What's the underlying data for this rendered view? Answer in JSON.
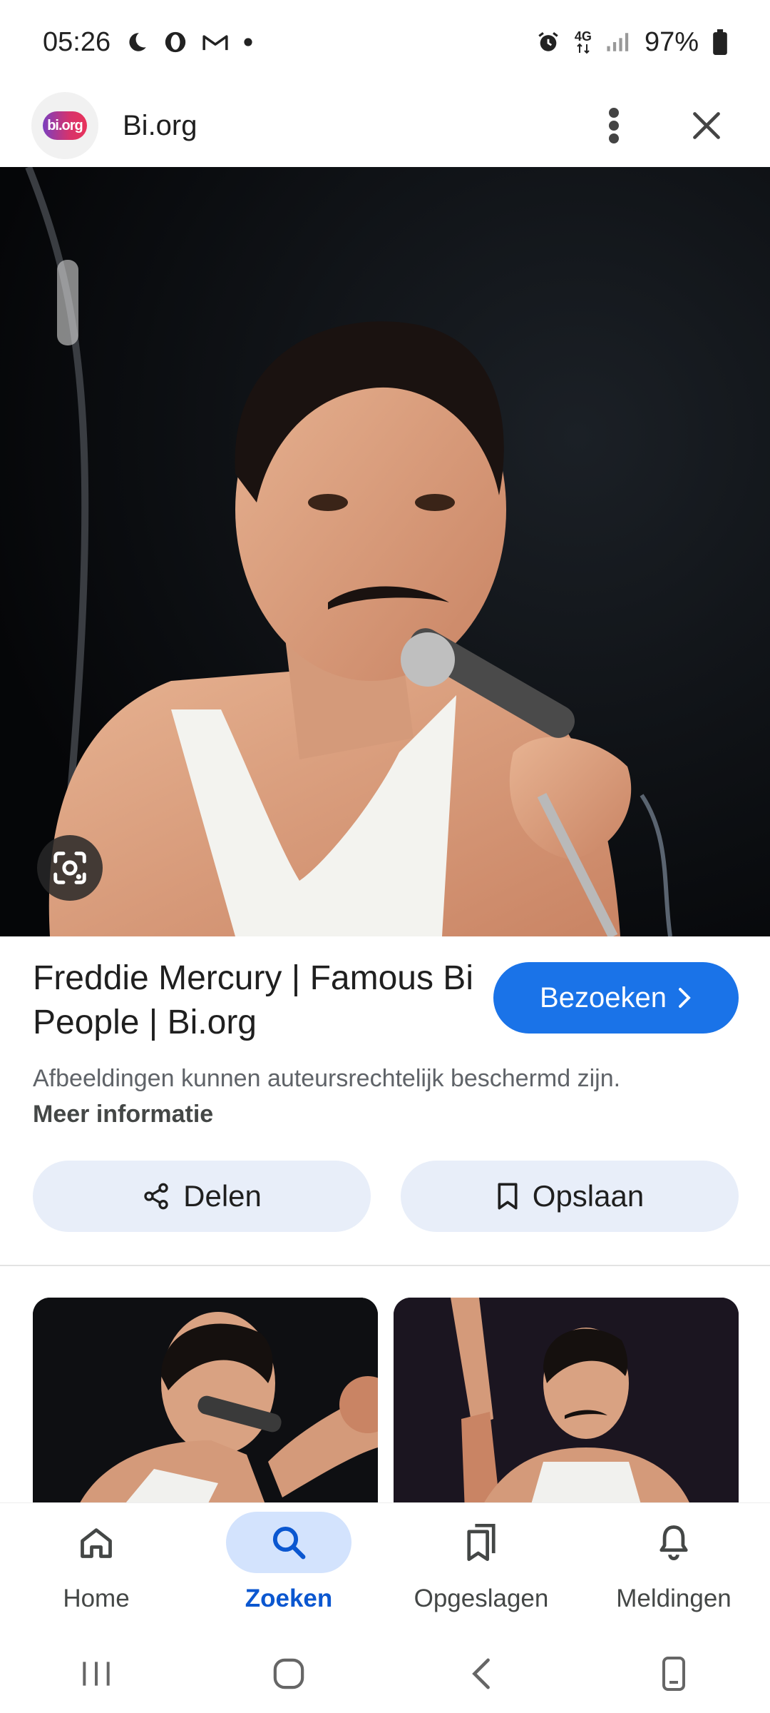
{
  "status_bar": {
    "time": "05:26",
    "battery": "97%",
    "network": "4G",
    "left_icons": [
      "moon-icon",
      "opera-icon",
      "gmail-icon",
      "dot-icon"
    ],
    "right_icons": [
      "alarm-icon",
      "network-4g-icon",
      "signal-icon",
      "battery-icon"
    ]
  },
  "header": {
    "logo_text": "bi.org",
    "site_name": "Bi.org",
    "menu_icon": "more-vert-icon",
    "close_icon": "close-icon"
  },
  "result": {
    "title": "Freddie Mercury | Famous Bi People | Bi.org",
    "visit_label": "Bezoeken",
    "copyright_text": "Afbeeldingen kunnen auteursrechtelijk beschermd zijn. ",
    "more_info_label": "Meer informatie",
    "share_label": "Delen",
    "save_label": "Opslaan"
  },
  "bottom_nav": {
    "items": [
      {
        "label": "Home",
        "icon": "home-icon",
        "active": false
      },
      {
        "label": "Zoeken",
        "icon": "search-icon",
        "active": true
      },
      {
        "label": "Opgeslagen",
        "icon": "saved-icon",
        "active": false
      },
      {
        "label": "Meldingen",
        "icon": "bell-icon",
        "active": false
      }
    ]
  },
  "colors": {
    "accent": "#1a73e8",
    "active_nav": "#0b57d0",
    "active_nav_bg": "#d3e3fd",
    "pill_bg": "#e8eef9"
  }
}
